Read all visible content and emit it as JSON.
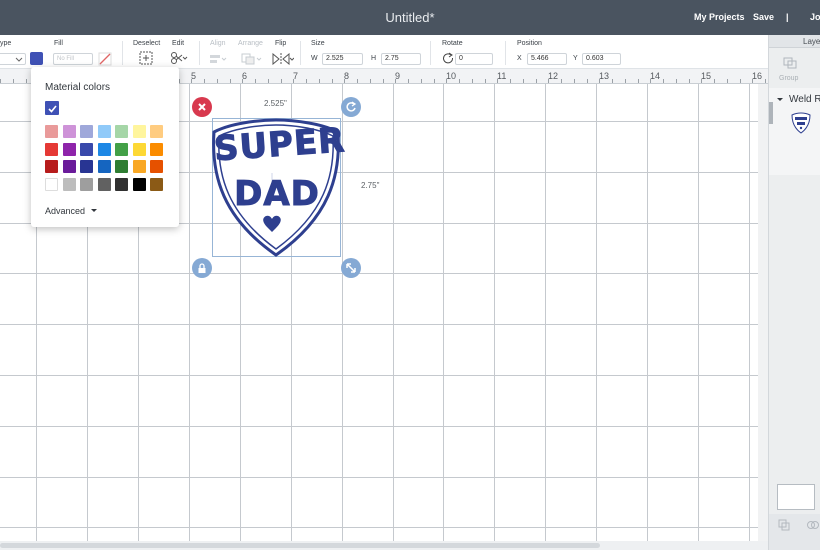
{
  "app": {
    "title": "Untitled*",
    "nav": {
      "my_projects": "My Projects",
      "save": "Save",
      "separator": "|",
      "user_partial": "Jo"
    }
  },
  "toolbar": {
    "linetype_label": "ype",
    "fill_label": "Fill",
    "fill_value": "No Fill",
    "deselect_label": "Deselect",
    "edit_label": "Edit",
    "align_label": "Align",
    "arrange_label": "Arrange",
    "flip_label": "Flip",
    "size_label": "Size",
    "w_label": "W",
    "w_value": "2.525",
    "h_label": "H",
    "h_value": "2.75",
    "rotate_label": "Rotate",
    "rotate_value": "0",
    "position_label": "Position",
    "x_label": "X",
    "x_value": "5.466",
    "y_label": "Y",
    "y_value": "0.603",
    "current_color": "#3f51b5"
  },
  "ruler": {
    "numbers": [
      "5",
      "6",
      "7",
      "8",
      "9",
      "10",
      "11",
      "12",
      "13",
      "14",
      "15",
      "16"
    ]
  },
  "canvas": {
    "width_label": "2.525\"",
    "height_label": "2.75\"",
    "design_text_line1": "SUPER",
    "design_text_line2": "DAD",
    "design_color": "#2e3f8f"
  },
  "color_popup": {
    "title": "Material colors",
    "advanced_label": "Advanced",
    "selected_color": "#3f51b5",
    "swatches": [
      [
        "#e99a9a",
        "#ce93d8",
        "#9fa8da",
        "#90caf9",
        "#a5d6a7",
        "#fff59d",
        "#ffcc80"
      ],
      [
        "#e53935",
        "#8e24aa",
        "#3949ab",
        "#1e88e5",
        "#43a047",
        "#fdd835",
        "#fb8c00"
      ],
      [
        "#b71c1c",
        "#6a1b9a",
        "#283593",
        "#1565c0",
        "#2e7d32",
        "#f9a825",
        "#e65100"
      ],
      [
        "#ffffff",
        "#bdbdbd",
        "#9e9e9e",
        "#616161",
        "#303030",
        "#000000",
        "#8b5a16"
      ]
    ]
  },
  "layers": {
    "header": "Laye",
    "group_label": "Group",
    "weld_label": "Weld Re",
    "thumb_text": "SUPER DAD"
  }
}
